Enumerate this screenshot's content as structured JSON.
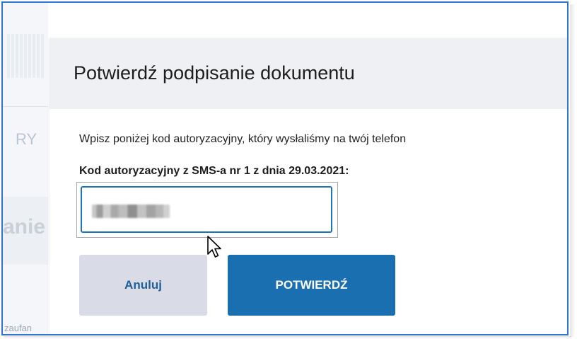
{
  "background": {
    "fragment_text_1": "RY",
    "fragment_text_2": "anie",
    "fragment_text_3": "zaufan"
  },
  "dialog": {
    "title": "Potwierdź podpisanie dokumentu",
    "instruction": "Wpisz poniżej kod autoryzacyjny, który wysłaliśmy na twój telefon",
    "code_label": "Kod autoryzacyjny z SMS-a nr 1 z dnia 29.03.2021:",
    "cancel_label": "Anuluj",
    "confirm_label": "POTWIERDŹ"
  },
  "colors": {
    "accent": "#1a6fb0",
    "cancel_bg": "#d9dce6",
    "header_bg": "#eef0f3",
    "input_focus_border": "#1d73b8"
  },
  "icons": {
    "pointer": "arrow-cursor-icon"
  }
}
